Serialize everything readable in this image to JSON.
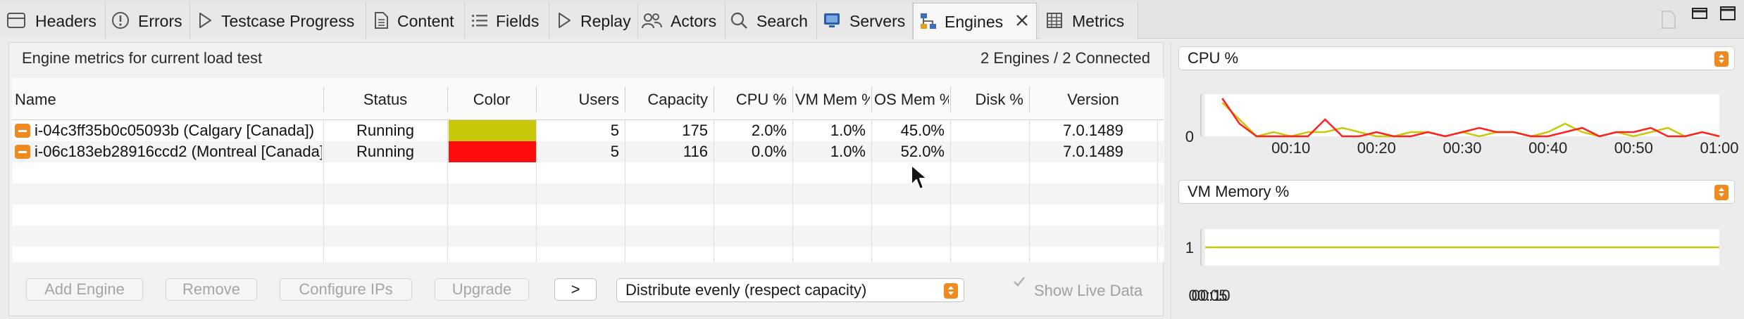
{
  "tabs": [
    {
      "label": "Headers",
      "icon": "window-icon"
    },
    {
      "label": "Errors",
      "icon": "exclamation-circle-icon"
    },
    {
      "label": "Testcase Progress",
      "icon": "play-outline-icon"
    },
    {
      "label": "Content",
      "icon": "document-icon"
    },
    {
      "label": "Fields",
      "icon": "list-icon"
    },
    {
      "label": "Replay",
      "icon": "play-outline-icon"
    },
    {
      "label": "Actors",
      "icon": "users-icon"
    },
    {
      "label": "Search",
      "icon": "search-icon"
    },
    {
      "label": "Servers",
      "icon": "monitor-icon"
    },
    {
      "label": "Engines",
      "icon": "network-icon",
      "active": true
    },
    {
      "label": "Metrics",
      "icon": "grid-icon"
    }
  ],
  "panel": {
    "title": "Engine metrics for current load test",
    "status": "2 Engines / 2 Connected"
  },
  "table": {
    "columns": [
      "Name",
      "Status",
      "Color",
      "Users",
      "Capacity",
      "CPU %",
      "VM Mem %",
      "OS Mem %",
      "Disk %",
      "Version"
    ],
    "rows": [
      {
        "name": "i-04c3ff35b0c05093b (Calgary [Canada])",
        "status": "Running",
        "color": "#c8c80a",
        "users": "5",
        "capacity": "175",
        "cpu": "2.0%",
        "vm_mem": "1.0%",
        "os_mem": "45.0%",
        "disk": "",
        "version": "7.0.1489"
      },
      {
        "name": "i-06c183eb28916ccd2 (Montreal [Canada])",
        "status": "Running",
        "color": "#ff0d0d",
        "users": "5",
        "capacity": "116",
        "cpu": "0.0%",
        "vm_mem": "1.0%",
        "os_mem": "52.0%",
        "disk": "",
        "version": "7.0.1489"
      }
    ]
  },
  "buttons": {
    "add_engine": "Add Engine",
    "remove": "Remove",
    "configure_ips": "Configure IPs",
    "upgrade": "Upgrade",
    "more": ">"
  },
  "distribution_select": "Distribute evenly (respect capacity)",
  "show_live_data": {
    "label": "Show Live Data",
    "checked": true
  },
  "charts": {
    "cpu_select": "CPU %",
    "vm_select": "VM Memory %"
  },
  "chart_data": [
    {
      "type": "line",
      "title": "",
      "xlabel": "",
      "ylabel": "",
      "x_ticks": [
        "00:10",
        "00:20",
        "00:30",
        "00:40",
        "00:50",
        "01:00"
      ],
      "y_ticks": [
        "0"
      ],
      "xlim": [
        0,
        60
      ],
      "ylim": [
        0,
        10
      ],
      "grid": false,
      "series": [
        {
          "color": "#c8c80a",
          "x": [
            2,
            4,
            6,
            8,
            10,
            12,
            14,
            16,
            18,
            20,
            22,
            24,
            26,
            28,
            30,
            32,
            34,
            36,
            38,
            40,
            42,
            44,
            46,
            48,
            50,
            52,
            54,
            56,
            58,
            60
          ],
          "y": [
            8,
            4,
            0,
            1,
            0,
            1,
            1,
            2,
            1,
            0,
            0,
            1,
            1,
            0,
            1,
            0,
            1,
            1,
            0,
            1,
            3,
            1,
            0,
            1,
            0,
            1,
            2,
            0,
            1,
            0
          ]
        },
        {
          "color": "#ff2020",
          "x": [
            2,
            4,
            6,
            8,
            10,
            12,
            14,
            16,
            18,
            20,
            22,
            24,
            26,
            28,
            30,
            32,
            34,
            36,
            38,
            40,
            42,
            44,
            46,
            48,
            50,
            52,
            54,
            56,
            58,
            60
          ],
          "y": [
            9,
            3,
            0,
            0,
            0,
            0,
            4,
            0,
            0,
            1,
            0,
            0,
            1,
            0,
            1,
            2,
            1,
            1,
            0,
            0,
            1,
            2,
            0,
            1,
            1,
            2,
            0,
            0,
            1,
            0
          ]
        }
      ]
    },
    {
      "type": "line",
      "title": "",
      "xlabel": "",
      "ylabel": "",
      "x_ticks": [
        "00:05",
        "00:10"
      ],
      "y_ticks": [
        "1"
      ],
      "xlim": [
        0,
        15
      ],
      "ylim": [
        0,
        2
      ],
      "grid": false,
      "series": [
        {
          "color": "#c8c80a",
          "x": [
            0,
            15
          ],
          "y": [
            1,
            1
          ]
        }
      ]
    }
  ]
}
